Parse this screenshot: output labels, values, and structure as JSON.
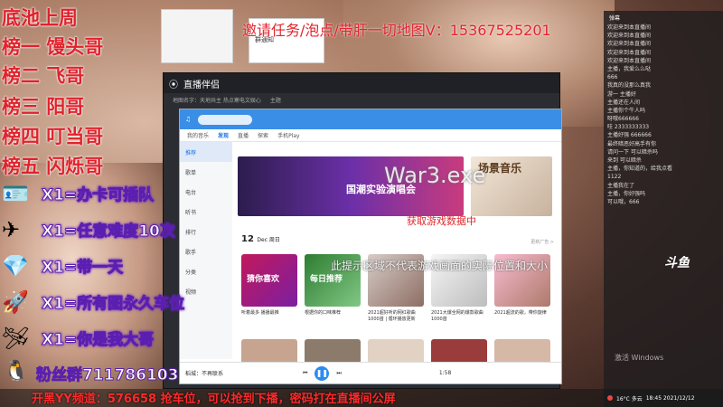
{
  "ranks": [
    "底池上周",
    "榜一 馒头哥",
    "榜二 飞哥",
    "榜三 阳哥",
    "榜四 叮当哥",
    "榜五 闪烁哥"
  ],
  "perks": [
    {
      "icon": "card-icon",
      "glyph": "🪪",
      "text": "X1=办卡可插队"
    },
    {
      "icon": "plane-icon",
      "glyph": "✈",
      "text": "X1=任意难度10次"
    },
    {
      "icon": "gem-icon",
      "glyph": "💎",
      "text": "X1=带一天"
    },
    {
      "icon": "rocket-icon",
      "glyph": "🚀",
      "text": "X1=所有图永久车位"
    },
    {
      "icon": "plane2-icon",
      "glyph": "🛩",
      "text": "X1=你是我大哥"
    }
  ],
  "qq": "粉丝群711786103",
  "invite": "邀请任务/泡点/带肝一切地图V：15367525201",
  "bottom": "开黑YY频道：576658 抢车位，可以抢到下播，密码打在直播间公屏",
  "zhibo_title": "直播伴侣",
  "zhibo_tabs": [
    "地图名字：天地共主 热点寒电文娱心",
    "主题"
  ],
  "mini2_text": "群通知",
  "music": {
    "nav": [
      "我的音乐",
      "发现",
      "直播",
      "探索",
      "手机Play"
    ],
    "side": [
      "推荐",
      "歌单",
      "电台",
      "听书",
      "排行",
      "歌手",
      "分类",
      "视频"
    ],
    "banner": "国潮实验演唱会",
    "banner2": "场景音乐",
    "day": "12",
    "day_sub": "Dec 周日",
    "more": "更新广告 >",
    "cards": [
      {
        "label": "猜你喜欢",
        "cap": "听着最多 播播最推"
      },
      {
        "label": "每日推荐",
        "cap": "根据你的口味推荐"
      },
      {
        "label": "",
        "cap": "2021超好听的网红歌曲 1000首 | 循环播放更新"
      },
      {
        "label": "",
        "cap": "2021大爆全网的爆款歌曲 1000首"
      },
      {
        "label": "",
        "cap": "2021超流的歌，带你旋律"
      }
    ],
    "player": "稻城：不再联系",
    "time": "1:58"
  },
  "war": "War3.exe",
  "fetch": "获取游戏数据中",
  "watermark": "此提示区域不代表游戏画面的实际位置和大小",
  "chat": {
    "header": "弹幕",
    "lines": [
      "欢迎来到本直播间",
      "欢迎来到本直播间",
      "欢迎来到本直播间",
      "欢迎来到本直播间",
      "欢迎来到本直播间",
      "主播，我爱么么哒",
      "666",
      "我真的没那么真我",
      "游一 主播好",
      "主播还在人间",
      "主播你个牛人吗",
      "呀哦666666",
      "哇 2333333333",
      "主播好强 666666",
      "最终暗恶好高手有你",
      "请问一下 可以暗杀吗",
      "来到 可以暗杀",
      "主播，你知道的，给我点看",
      "1122",
      "主播我在了",
      "主播，你好强吗",
      "可以哦，666"
    ],
    "logo": "斗鱼"
  },
  "win": "激活 Windows",
  "clock": "18:45 2021/12/12",
  "temp": "16°C 多云"
}
